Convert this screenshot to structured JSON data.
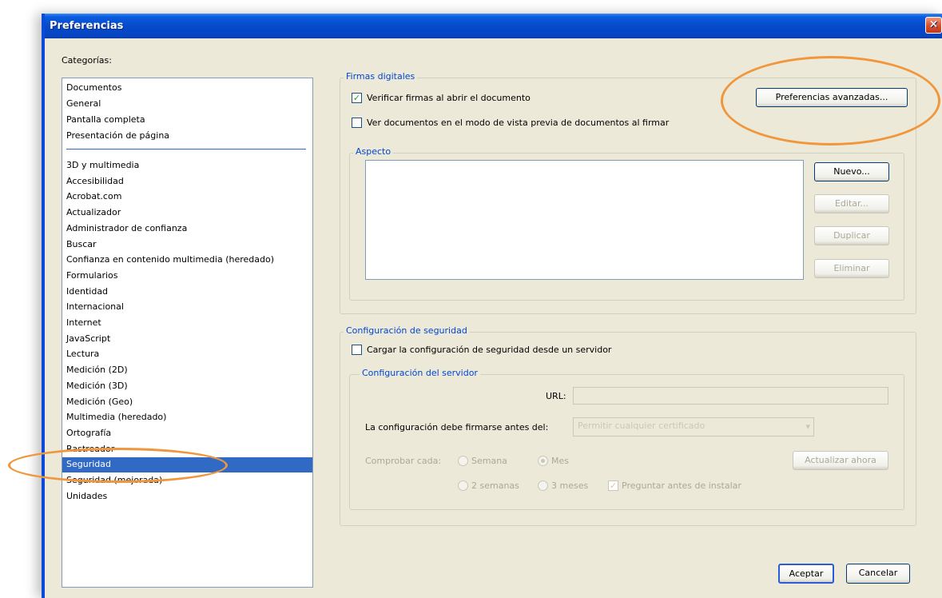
{
  "window": {
    "title": "Preferencias",
    "close_glyph": "✕"
  },
  "categories": {
    "label": "Categorías:",
    "group1": [
      "Documentos",
      "General",
      "Pantalla completa",
      "Presentación de página"
    ],
    "group2": [
      "3D y multimedia",
      "Accesibilidad",
      "Acrobat.com",
      "Actualizador",
      "Administrador de confianza",
      "Buscar",
      "Confianza en contenido multimedia (heredado)",
      "Formularios",
      "Identidad",
      "Internacional",
      "Internet",
      "JavaScript",
      "Lectura",
      "Medición (2D)",
      "Medición (3D)",
      "Medición (Geo)",
      "Multimedia (heredado)",
      "Ortografía",
      "Rastreador",
      "Seguridad",
      "Seguridad (mejorada)",
      "Unidades"
    ],
    "selected": "Seguridad"
  },
  "firmas": {
    "title": "Firmas digitales",
    "verificar_label": "Verificar firmas al abrir el documento",
    "verificar_checked": true,
    "ver_docs_label": "Ver documentos en el modo de vista previa de documentos al firmar",
    "ver_docs_checked": false,
    "advanced_button": "Preferencias avanzadas...",
    "aspecto": {
      "title": "Aspecto",
      "nuevo": "Nuevo...",
      "editar": "Editar...",
      "duplicar": "Duplicar",
      "eliminar": "Eliminar"
    }
  },
  "seguridad": {
    "title": "Configuración de seguridad",
    "cargar_label": "Cargar la configuración de seguridad desde un servidor",
    "cargar_checked": false,
    "servidor": {
      "title": "Configuración del servidor",
      "url_label": "URL:",
      "url_value": "",
      "firmar_label": "La configuración debe firmarse antes del:",
      "firmar_value": "Permitir cualquier certificado",
      "comprobar_label": "Comprobar cada:",
      "opt_semana": "Semana",
      "opt_mes": "Mes",
      "opt_2semanas": "2 semanas",
      "opt_3meses": "3 meses",
      "selected_option": "Mes",
      "preguntar_label": "Preguntar antes de instalar",
      "preguntar_checked": true,
      "actualizar": "Actualizar ahora"
    }
  },
  "footer": {
    "aceptar": "Aceptar",
    "cancelar": "Cancelar"
  },
  "annotations": {
    "highlight_color": "#f0963c"
  }
}
